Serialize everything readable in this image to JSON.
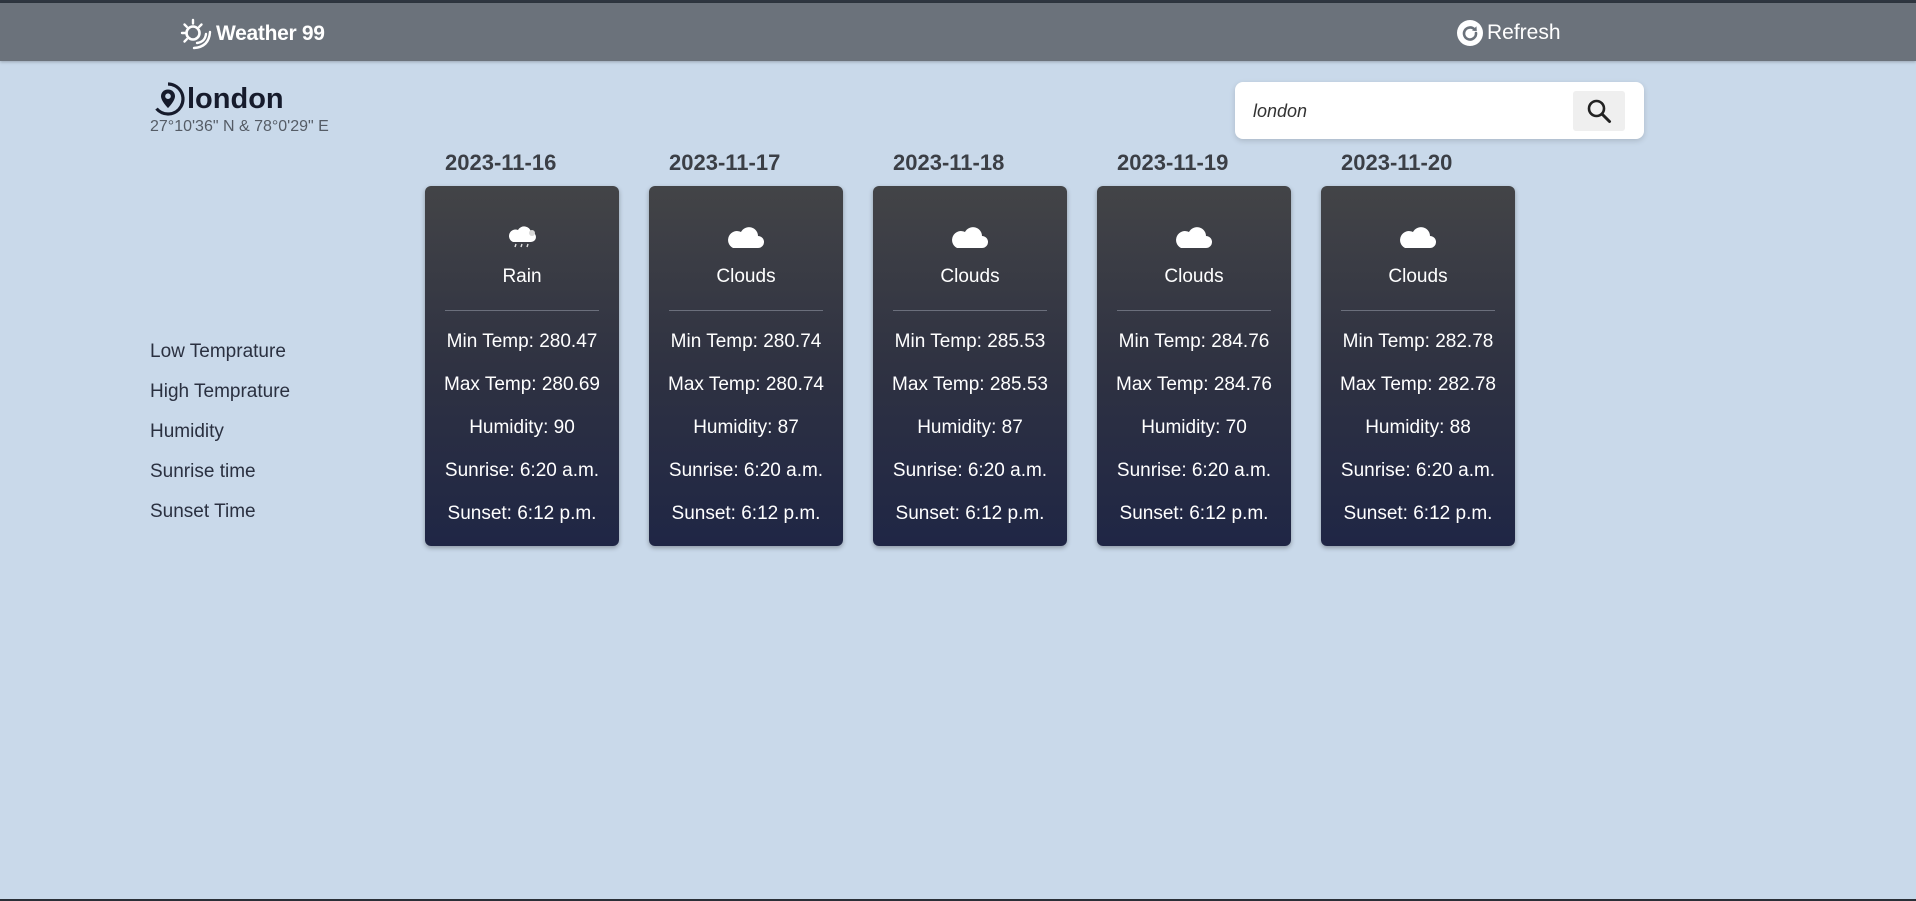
{
  "nav": {
    "brand": "Weather 99",
    "refresh_label": "Refresh"
  },
  "location": {
    "name": "london",
    "coords": "27°10'36\" N & 78°0'29\" E"
  },
  "search": {
    "value": "london"
  },
  "row_labels": [
    "Low Temprature",
    "High Temprature",
    "Humidity",
    "Sunrise time",
    "Sunset Time"
  ],
  "days": [
    {
      "date": "2023-11-16",
      "condition": "Rain",
      "icon": "cloud-rain-icon",
      "min": "Min Temp: 280.47",
      "max": "Max Temp: 280.69",
      "humidity": "Humidity: 90",
      "sunrise": "Sunrise: 6:20 a.m.",
      "sunset": "Sunset: 6:12 p.m."
    },
    {
      "date": "2023-11-17",
      "condition": "Clouds",
      "icon": "cloud-icon",
      "min": "Min Temp: 280.74",
      "max": "Max Temp: 280.74",
      "humidity": "Humidity: 87",
      "sunrise": "Sunrise: 6:20 a.m.",
      "sunset": "Sunset: 6:12 p.m."
    },
    {
      "date": "2023-11-18",
      "condition": "Clouds",
      "icon": "cloud-icon",
      "min": "Min Temp: 285.53",
      "max": "Max Temp: 285.53",
      "humidity": "Humidity: 87",
      "sunrise": "Sunrise: 6:20 a.m.",
      "sunset": "Sunset: 6:12 p.m."
    },
    {
      "date": "2023-11-19",
      "condition": "Clouds",
      "icon": "cloud-icon",
      "min": "Min Temp: 284.76",
      "max": "Max Temp: 284.76",
      "humidity": "Humidity: 70",
      "sunrise": "Sunrise: 6:20 a.m.",
      "sunset": "Sunset: 6:12 p.m."
    },
    {
      "date": "2023-11-20",
      "condition": "Clouds",
      "icon": "cloud-icon",
      "min": "Min Temp: 282.78",
      "max": "Max Temp: 282.78",
      "humidity": "Humidity: 88",
      "sunrise": "Sunrise: 6:20 a.m.",
      "sunset": "Sunset: 6:12 p.m."
    }
  ],
  "colors": {
    "page_bg": "#c9d9ea",
    "navbar_bg": "#6b727b",
    "card_top": "#434447",
    "card_bottom": "#1f2645"
  }
}
